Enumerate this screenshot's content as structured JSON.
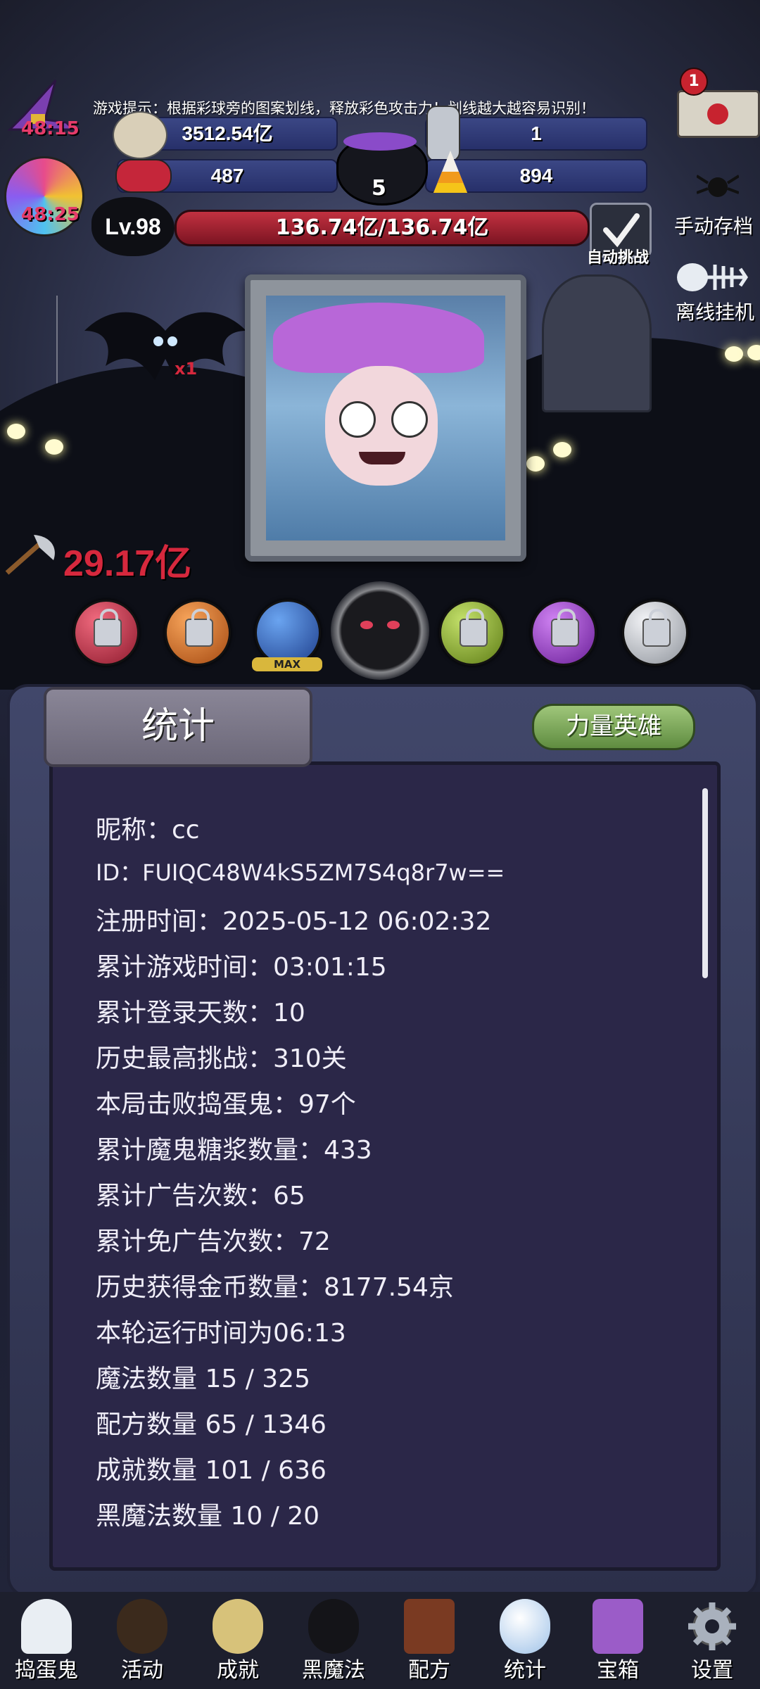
{
  "tip": "游戏提示：根据彩球旁的图案划线，释放彩色攻击力！划线越大越容易识别！",
  "timers": {
    "hat_timer": "48:15",
    "candy_timer": "48:25"
  },
  "resources": {
    "cookies": "3512.54亿",
    "potion": "1",
    "candy_skull": "487",
    "candy_corn": "894",
    "cauldron_count": "5"
  },
  "mail_badge": "1",
  "player": {
    "level": "Lv.98",
    "hp": "136.74亿/136.74亿"
  },
  "buttons": {
    "auto_challenge": "自动挑战",
    "manual_save": "手动存档",
    "offline_idle": "离线挂机",
    "power_hero": "力量英雄"
  },
  "bat_multiplier": "x1",
  "damage": "29.17亿",
  "orbs": {
    "max_label": "MAX",
    "items": [
      {
        "color": "#c8324a",
        "locked": true
      },
      {
        "color": "#e4792a",
        "locked": true
      },
      {
        "color": "#3a6fd0",
        "locked": false
      },
      {
        "color": "#111111",
        "locked": false
      },
      {
        "color": "#90b83a",
        "locked": true
      },
      {
        "color": "#9a48c8",
        "locked": true
      },
      {
        "color": "#c9ccd2",
        "locked": true
      }
    ]
  },
  "panel": {
    "title": "统计",
    "stats": [
      "昵称：cc",
      "ID：FUIQC48W4kS5ZM7S4q8r7w==",
      "注册时间：2025-05-12 06:02:32",
      "累计游戏时间：03:01:15",
      "累计登录天数：10",
      "历史最高挑战：310关",
      "本局击败捣蛋鬼：97个",
      "累计魔鬼糖浆数量：433",
      "累计广告次数：65",
      "累计免广告次数：72",
      "历史获得金币数量：8177.54京",
      "本轮运行时间为06:13",
      "魔法数量 15 / 325",
      "配方数量 65 / 1346",
      "成就数量 101 / 636",
      "黑魔法数量 10 / 20"
    ]
  },
  "nav": [
    "捣蛋鬼",
    "活动",
    "成就",
    "黑魔法",
    "配方",
    "统计",
    "宝箱",
    "设置"
  ]
}
